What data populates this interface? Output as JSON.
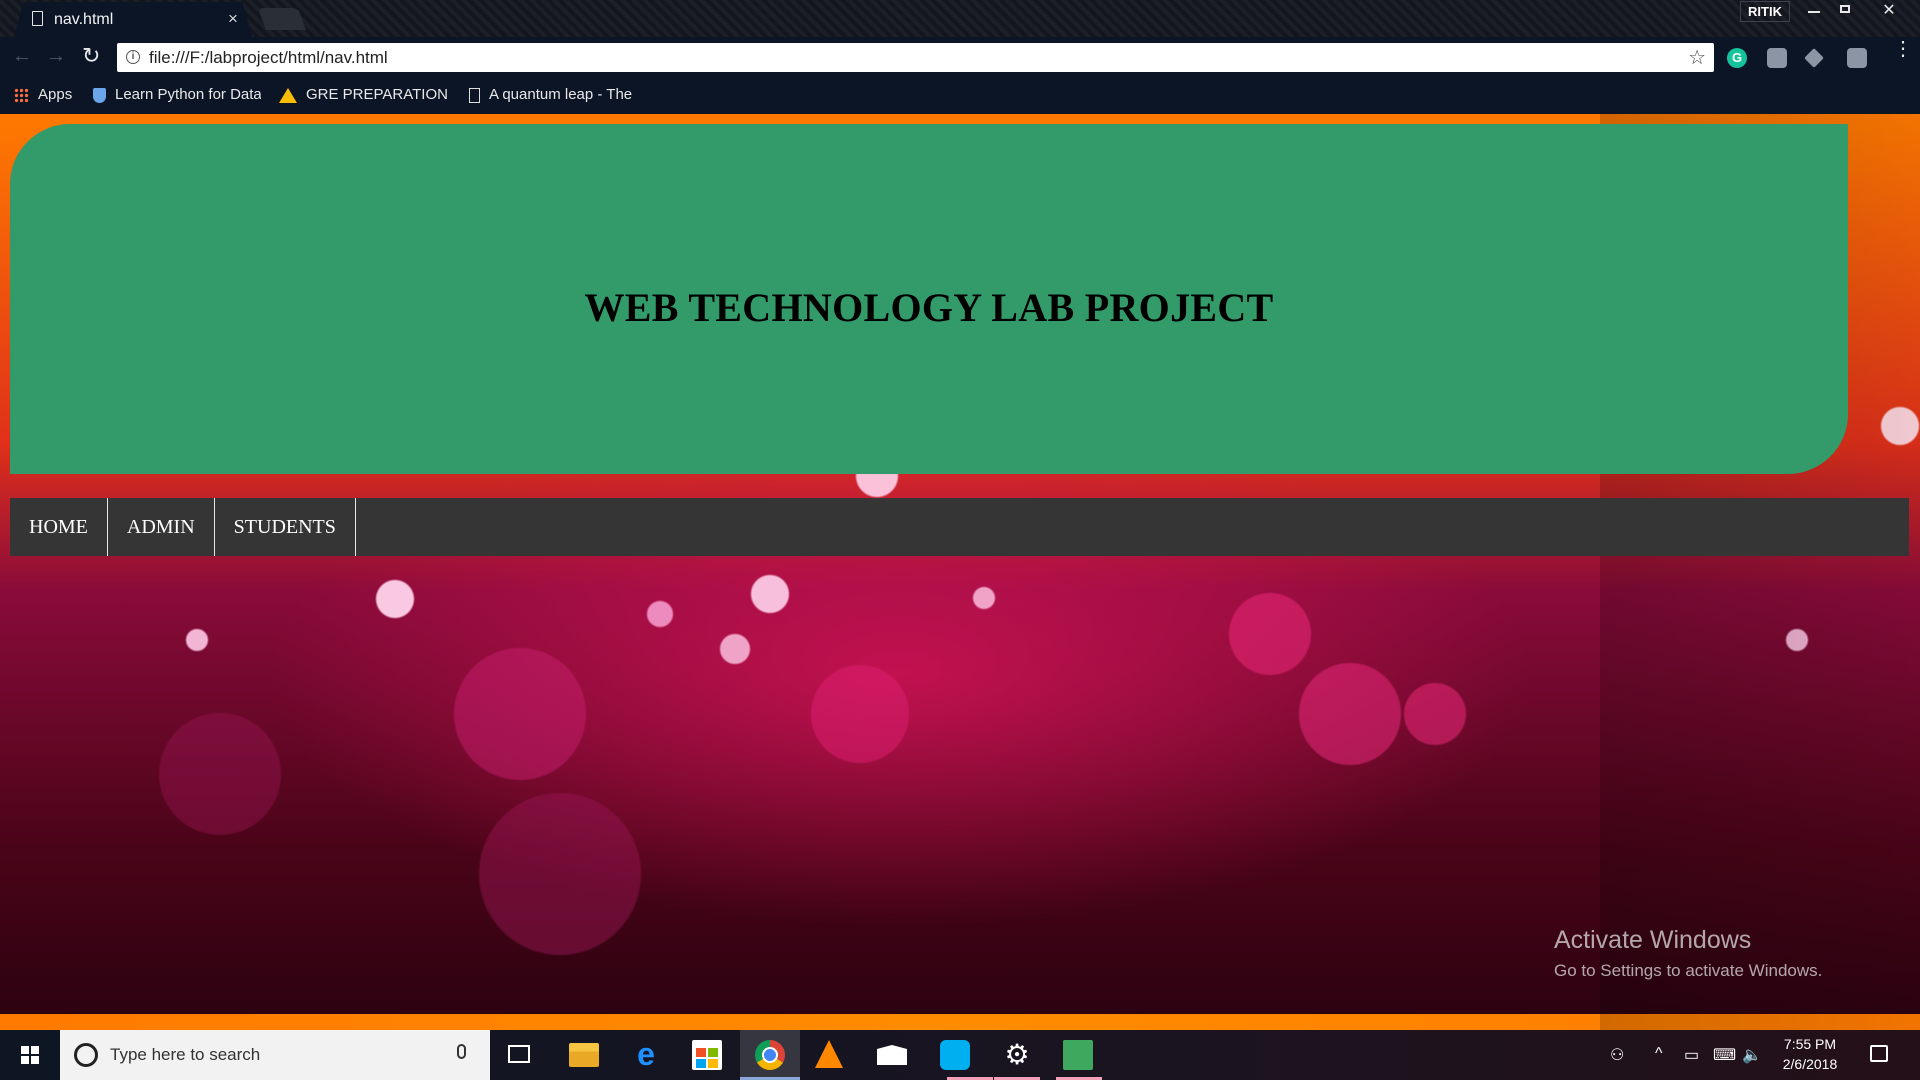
{
  "browser": {
    "tab_title": "nav.html",
    "tab_close": "×",
    "profile_name": "RITIK",
    "url": "file:///F:/labproject/html/nav.html",
    "nav_back": "←",
    "nav_forward": "→",
    "reload": "↻",
    "star": "☆",
    "grammarly": "G",
    "menu": "⋮",
    "info": "i",
    "bookmarks": [
      {
        "label": "Apps",
        "icon": "apps-grid-icon"
      },
      {
        "label": "Learn Python for Data",
        "icon": "shield-icon"
      },
      {
        "label": "GRE PREPARATION M",
        "icon": "google-drive-icon"
      },
      {
        "label": "A quantum leap - The",
        "icon": "document-icon"
      }
    ]
  },
  "page": {
    "header_title": "WEB TECHNOLOGY LAB PROJECT",
    "header_color": "#339b6a",
    "nav_bg_color": "#353535",
    "nav_items": [
      "HOME",
      "ADMIN",
      "STUDENTS"
    ]
  },
  "watermark": {
    "line1": "Activate Windows",
    "line2": "Go to Settings to activate Windows."
  },
  "taskbar": {
    "search_placeholder": "Type here to search",
    "time": "7:55 PM",
    "date": "2/6/2018",
    "edge_glyph": "e",
    "settings_glyph": "⚙",
    "tray_people": "⚇",
    "tray_chevron": "^",
    "tray_battery": "▭",
    "tray_network": "⌨",
    "tray_volume": "🔈"
  }
}
